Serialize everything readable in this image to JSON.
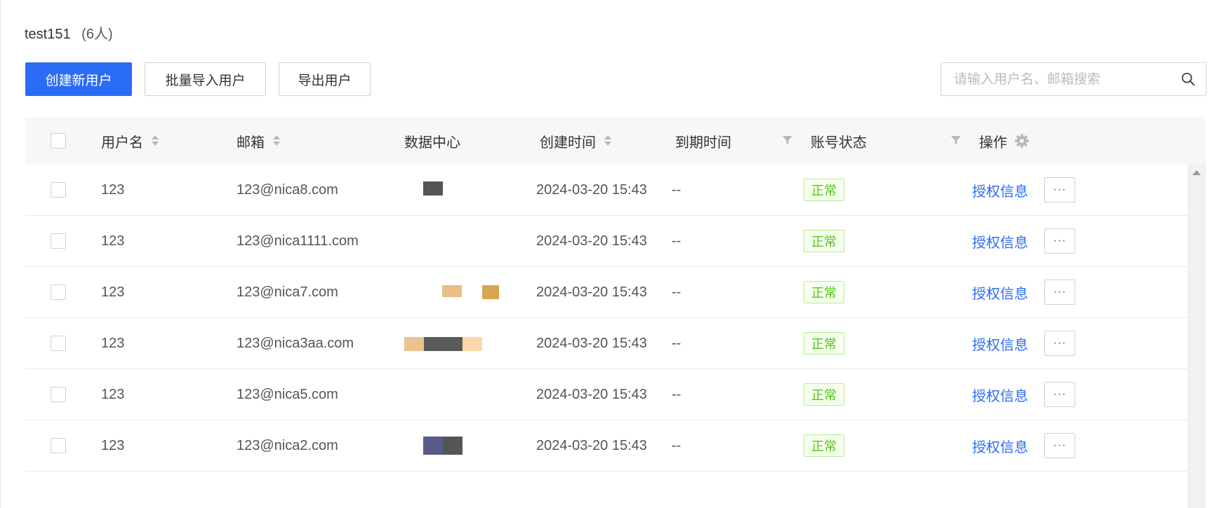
{
  "header": {
    "group_name": "test151",
    "member_count": "(6人)"
  },
  "toolbar": {
    "create_label": "创建新用户",
    "import_label": "批量导入用户",
    "export_label": "导出用户"
  },
  "search": {
    "placeholder": "请输入用户名、邮箱搜索",
    "value": ""
  },
  "table": {
    "columns": {
      "username": "用户名",
      "email": "邮箱",
      "datacenter": "数据中心",
      "created": "创建时间",
      "expires": "到期时间",
      "status": "账号状态",
      "actions": "操作"
    },
    "rows": [
      {
        "username": "123",
        "email": "123@nica8.com",
        "created": "2024-03-20 15:43",
        "expires": "--",
        "status": "正常",
        "action": "授权信息",
        "more": "···"
      },
      {
        "username": "123",
        "email": "123@nica1111.com",
        "created": "2024-03-20 15:43",
        "expires": "--",
        "status": "正常",
        "action": "授权信息",
        "more": "···"
      },
      {
        "username": "123",
        "email": "123@nica7.com",
        "created": "2024-03-20 15:43",
        "expires": "--",
        "status": "正常",
        "action": "授权信息",
        "more": "···"
      },
      {
        "username": "123",
        "email": "123@nica3aa.com",
        "created": "2024-03-20 15:43",
        "expires": "--",
        "status": "正常",
        "action": "授权信息",
        "more": "···"
      },
      {
        "username": "123",
        "email": "123@nica5.com",
        "created": "2024-03-20 15:43",
        "expires": "--",
        "status": "正常",
        "action": "授权信息",
        "more": "···"
      },
      {
        "username": "123",
        "email": "123@nica2.com",
        "created": "2024-03-20 15:43",
        "expires": "--",
        "status": "正常",
        "action": "授权信息",
        "more": "···"
      }
    ]
  },
  "colors": {
    "primary": "#2b6cf6",
    "status_green": "#52c41a",
    "header_bg": "#f7f7f7"
  },
  "icons": {
    "search": "search-icon",
    "sort": "sort-icon",
    "filter": "filter-icon",
    "settings": "gear-icon",
    "more": "more-icon"
  }
}
